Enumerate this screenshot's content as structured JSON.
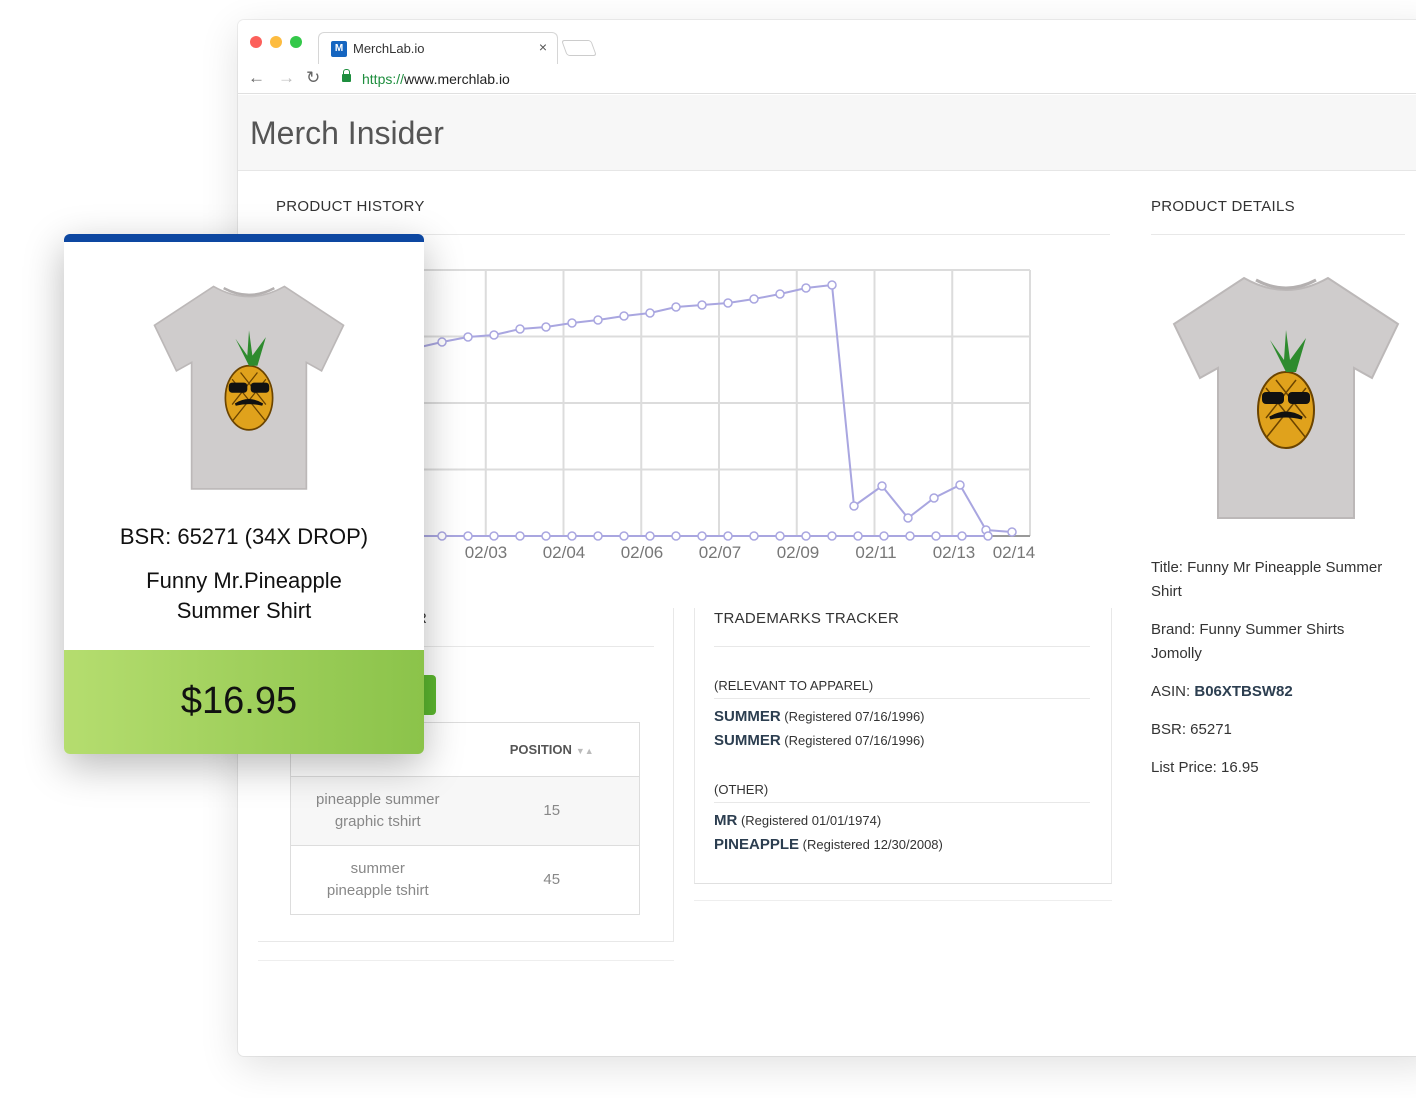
{
  "browser": {
    "tab_title": "MerchLab.io",
    "tab_favicon": "M",
    "close_glyph": "×",
    "url_scheme": "https://",
    "url_host": "www.merchlab.io"
  },
  "app": {
    "title": "Merch Insider"
  },
  "product_history": {
    "title": "PRODUCT HISTORY",
    "chart_data": {
      "type": "line",
      "x": [
        "02/03",
        "02/04",
        "02/06",
        "02/07",
        "02/09",
        "02/11",
        "02/13",
        "02/14"
      ],
      "y_ticks_visible": false,
      "grid": true,
      "line_color": "#a9a6e0"
    }
  },
  "keywords_panel": {
    "title_partial": "R",
    "table": {
      "headers": [
        "",
        "POSITION"
      ],
      "rows": [
        {
          "keyword": "pineapple summer graphic tshirt",
          "position": "15"
        },
        {
          "keyword": "summer pineapple tshirt",
          "position": "45"
        }
      ]
    }
  },
  "trademarks": {
    "title": "TRADEMARKS TRACKER",
    "relevant_label": "(RELEVANT TO APPAREL)",
    "relevant": [
      {
        "mark": "SUMMER",
        "reg": "(Registered 07/16/1996)"
      },
      {
        "mark": "SUMMER",
        "reg": "(Registered 07/16/1996)"
      }
    ],
    "other_label": "(OTHER)",
    "other": [
      {
        "mark": "MR",
        "reg": "(Registered 01/01/1974)"
      },
      {
        "mark": "PINEAPPLE",
        "reg": "(Registered 12/30/2008)"
      }
    ]
  },
  "product_details": {
    "title": "PRODUCT DETAILS",
    "title_line": "Title: Funny Mr Pineapple Summer Shirt",
    "brand_line": "Brand: Funny Summer Shirts Jomolly",
    "asin_label": "ASIN: ",
    "asin_value": "B06XTBSW82",
    "bsr_line": "BSR: 65271",
    "price_line": "List Price: 16.95"
  },
  "card": {
    "bsr": "BSR: 65271 (34X DROP)",
    "title": "Funny Mr.Pineapple Summer Shirt",
    "price": "$16.95"
  },
  "colors": {
    "card_top": "#0d47a1",
    "price_gradient_start": "#b5dd6f",
    "price_gradient_end": "#8bc34a",
    "green_button": "#5cb82f"
  }
}
